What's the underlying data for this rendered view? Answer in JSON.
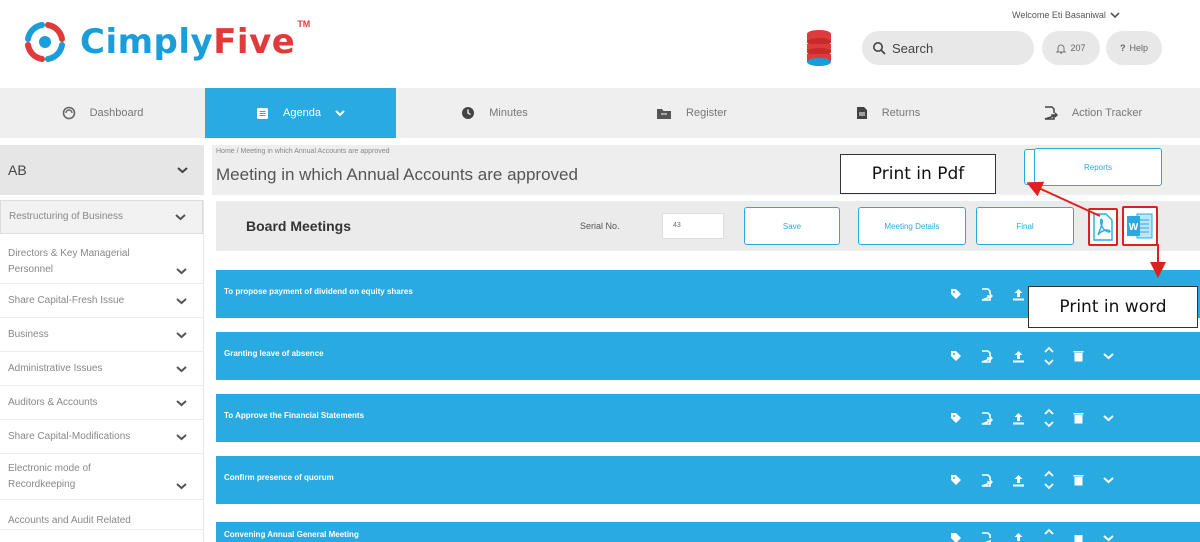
{
  "brand": {
    "name_part1": "Cimply",
    "name_part2": "Five",
    "tm": "TM",
    "colors": {
      "blue": "#1a9ed9",
      "red": "#e03a3a",
      "accent": "#29abe2"
    }
  },
  "header": {
    "welcome": "Welcome Eti Basaniwal",
    "search_placeholder": "Search",
    "notifications": "207",
    "help": "Help"
  },
  "nav": {
    "items": [
      {
        "label": "Dashboard",
        "icon": "dashboard-icon"
      },
      {
        "label": "Agenda",
        "icon": "agenda-icon",
        "active": true
      },
      {
        "label": "Minutes",
        "icon": "clock-icon"
      },
      {
        "label": "Register",
        "icon": "folder-icon"
      },
      {
        "label": "Returns",
        "icon": "document-icon"
      },
      {
        "label": "Action Tracker",
        "icon": "tracker-icon"
      }
    ]
  },
  "company": {
    "selected": "AB"
  },
  "sidebar": {
    "items": [
      {
        "label": "Restructuring of Business"
      },
      {
        "label": "Directors & Key Managerial Personnel"
      },
      {
        "label": "Share Capital-Fresh Issue"
      },
      {
        "label": "Business"
      },
      {
        "label": "Administrative Issues"
      },
      {
        "label": "Auditors & Accounts"
      },
      {
        "label": "Share Capital-Modifications"
      },
      {
        "label": "Electronic mode of Recordkeeping"
      },
      {
        "label": "Accounts and Audit Related"
      }
    ]
  },
  "breadcrumb": {
    "text": "Home  /  Meeting in which Annual Accounts are approved"
  },
  "page": {
    "title": "Meeting in which Annual Accounts are approved",
    "reports_label": "Reports"
  },
  "toolbar": {
    "title": "Board Meetings",
    "serial_label": "Serial No.",
    "serial_value": "43",
    "save_label": "Save",
    "meeting_details_label": "Meeting Details",
    "final_label": "Final"
  },
  "agenda": {
    "items": [
      {
        "title": "To propose payment of dividend on equity shares"
      },
      {
        "title": "Granting leave of absence"
      },
      {
        "title": "To Approve the Financial Statements"
      },
      {
        "title": "Confirm presence of quorum"
      },
      {
        "title": "Convening Annual General Meeting"
      }
    ]
  },
  "callouts": {
    "pdf": "Print in Pdf",
    "word": "Print in word"
  }
}
